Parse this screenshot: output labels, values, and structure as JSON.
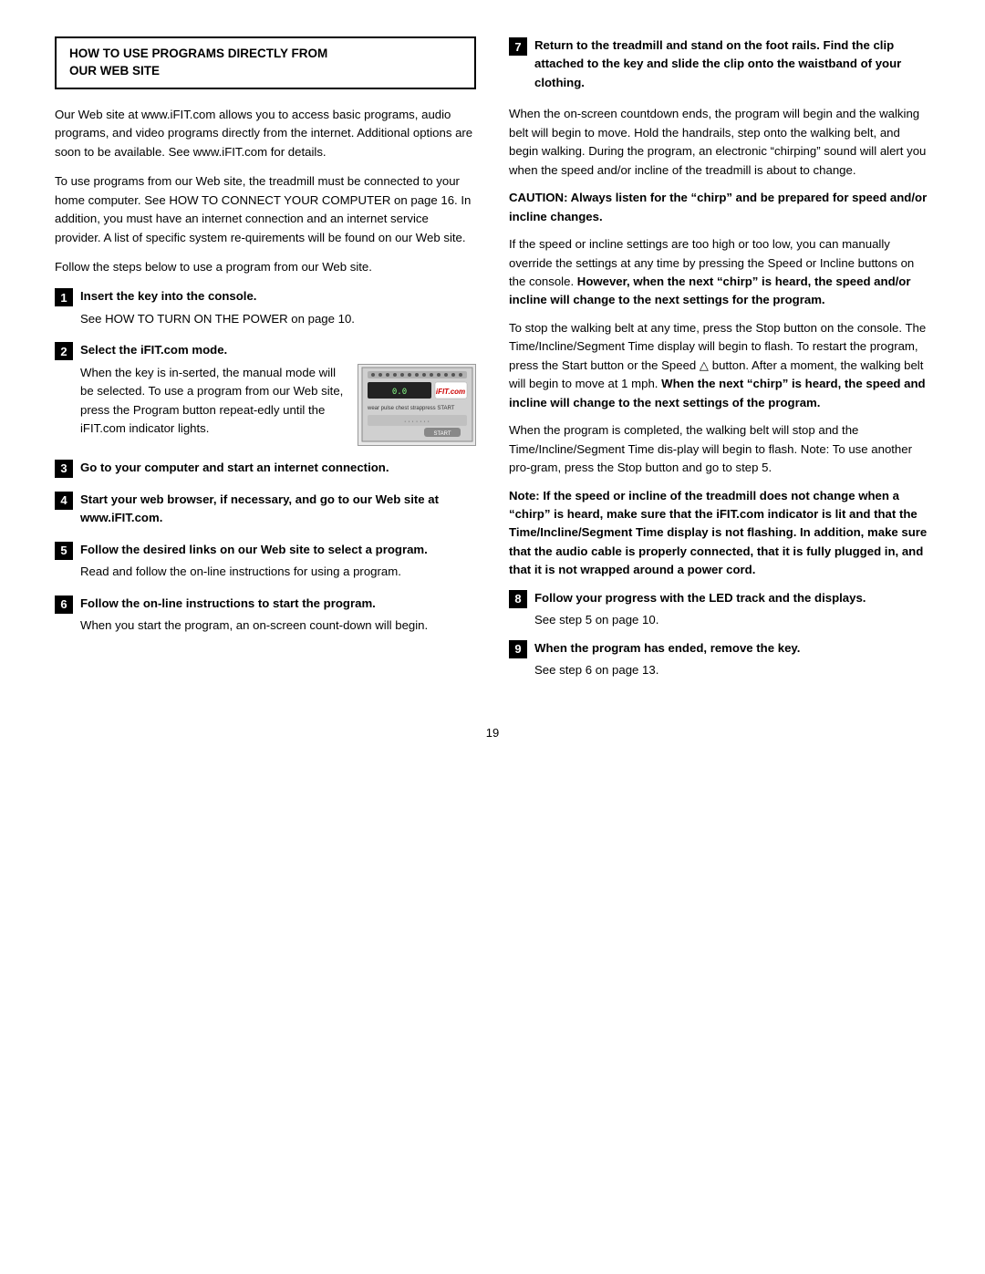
{
  "header": {
    "title_line1": "HOW TO USE PROGRAMS DIRECTLY FROM",
    "title_line2": "OUR WEB SITE"
  },
  "left_col": {
    "intro_paragraphs": [
      "Our Web site at www.iFIT.com allows you to access basic programs, audio programs, and video programs directly from the internet. Additional options are soon to be available. See www.iFIT.com for details.",
      "To use programs from our Web site, the treadmill must be connected to your home computer. See HOW TO CONNECT YOUR COMPUTER on page 16. In addition, you must have an internet connection and an internet service provider. A list of specific system re-quirements will be found on our Web site.",
      "Follow the steps below to use a program from our Web site."
    ],
    "steps": [
      {
        "number": "1",
        "title": "Insert the key into the console.",
        "body": "See HOW TO TURN ON THE POWER on page 10."
      },
      {
        "number": "2",
        "title": "Select the iFIT.com mode.",
        "body": "When the key is in-serted, the manual mode will be selected. To use a program from our Web site, press the Program button repeat-edly until the iFIT.com indicator lights."
      },
      {
        "number": "3",
        "title": "Go to your computer and start an internet connection."
      },
      {
        "number": "4",
        "title": "Start your web browser, if necessary, and go to our Web site at www.iFIT.com."
      },
      {
        "number": "5",
        "title": "Follow the desired links on our Web site to select a program.",
        "body": "Read and follow the on-line instructions for using a program."
      },
      {
        "number": "6",
        "title": "Follow the on-line instructions to start the program.",
        "body": "When you start the program, an on-screen count-down will begin."
      }
    ]
  },
  "right_col": {
    "step7": {
      "number": "7",
      "title": "Return to the treadmill and stand on the foot rails. Find the clip attached to the key and slide the clip onto the waistband of your clothing."
    },
    "para1": "When the on-screen countdown ends, the program will begin and the walking belt will begin to move. Hold the handrails, step onto the walking belt, and begin walking. During the program, an electronic “chirping” sound will alert you when the speed and/or incline of the treadmill is about to change.",
    "caution": "CAUTION: Always listen for the “chirp” and be prepared for speed and/or incline changes.",
    "para2": "If the speed or incline settings are too high or too low, you can manually override the settings at any time by pressing the Speed or Incline buttons on the console.",
    "bold_inline": "However, when the next “chirp” is heard, the speed and/or incline will change to the next settings for the program.",
    "para3": "To stop the walking belt at any time, press the Stop button on the console. The Time/Incline/Segment Time display will begin to flash. To restart the program, press the Start button or the Speed △ button. After a moment, the walking belt will begin to move at 1 mph.",
    "bold_inline2": "When the next “chirp” is heard, the speed and incline will change to the next settings of the program.",
    "para4": "When the program is completed, the walking belt will stop and the Time/Incline/Segment Time dis-play will begin to flash. Note: To use another pro-gram, press the Stop button and go to step 5.",
    "note": "Note: If the speed or incline of the treadmill does not change when a “chirp” is heard, make sure that the iFIT.com indicator is lit and that the Time/Incline/Segment Time display is not flashing. In addition, make sure that the audio cable is properly connected, that it is fully plugged in, and that it is not wrapped around a power cord.",
    "step8": {
      "number": "8",
      "title": "Follow your progress with the LED track and the displays.",
      "body": "See step 5 on page 10."
    },
    "step9": {
      "number": "9",
      "title": "When the program has ended, remove the key.",
      "body": "See step 6 on page 13."
    }
  },
  "page_number": "19"
}
